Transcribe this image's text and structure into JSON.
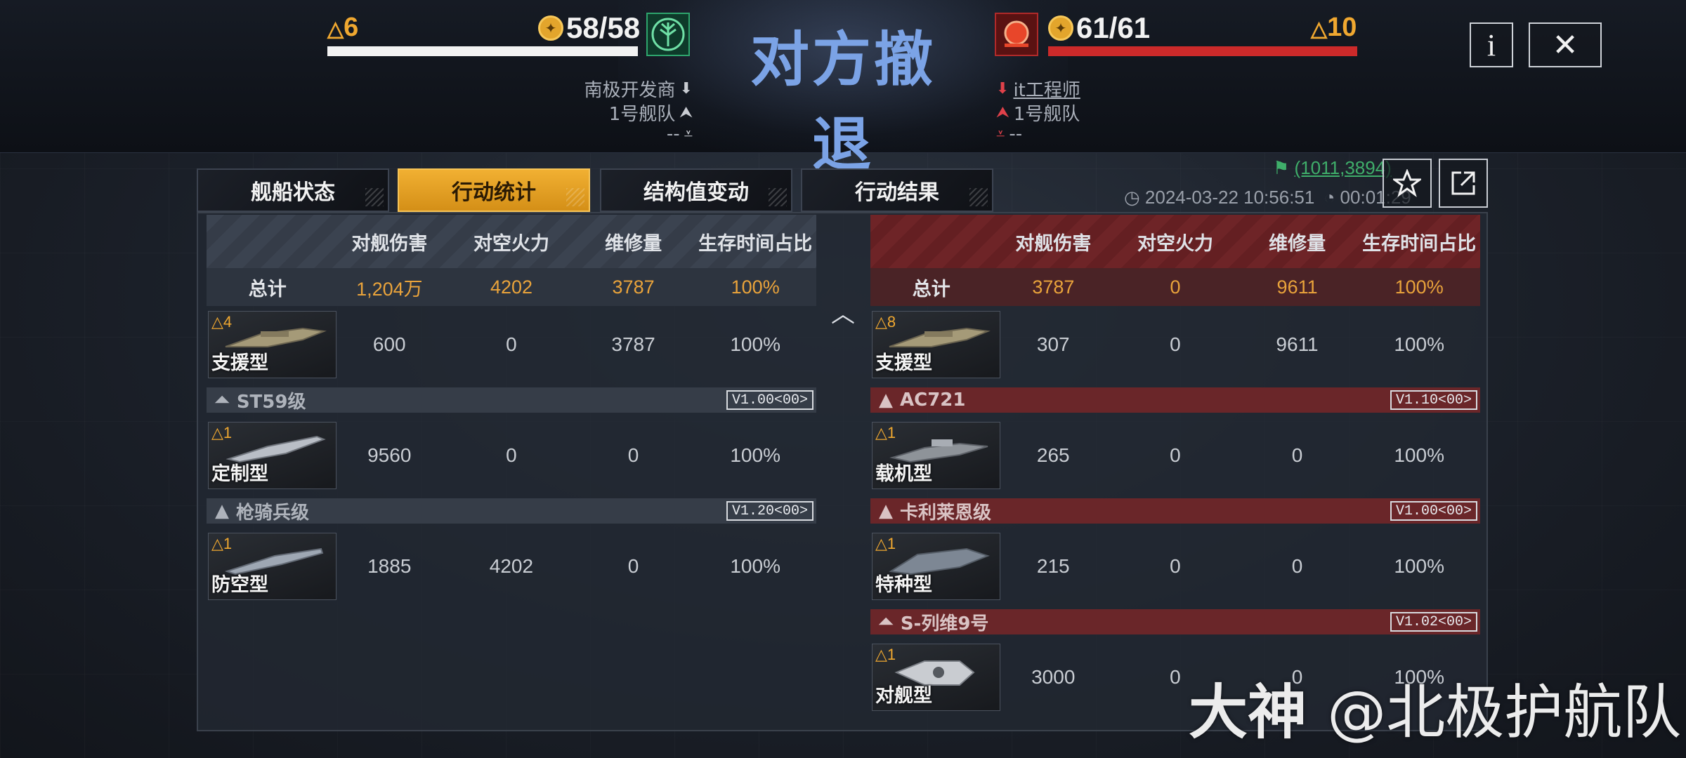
{
  "header": {
    "title": "对方撤退",
    "left": {
      "tri_count": "6",
      "ships": "58/58",
      "hp_color": "#f2f2f2",
      "player_name": "南极开发商",
      "fleet": "1号舰队",
      "extra": "--"
    },
    "right": {
      "tri_count": "10",
      "ships": "61/61",
      "hp_color": "#cc2a2a",
      "player_name": "it工程师",
      "fleet": "1号舰队",
      "extra": "--"
    },
    "info_label": "i",
    "close_label": "✕"
  },
  "tabs": [
    {
      "label": "舰船状态",
      "active": false
    },
    {
      "label": "行动统计",
      "active": true
    },
    {
      "label": "结构值变动",
      "active": false
    },
    {
      "label": "行动结果",
      "active": false
    }
  ],
  "meta": {
    "coordinates": "(1011,3894)",
    "datetime": "2024-03-22 10:56:51",
    "duration": "00:01:29"
  },
  "columns": [
    "对舰伤害",
    "对空火力",
    "维修量",
    "生存时间占比"
  ],
  "left_side": {
    "total_label": "总计",
    "totals": [
      "1,204万",
      "4202",
      "3787",
      "100%"
    ],
    "groups": [
      {
        "class_name": "",
        "version": "",
        "ships": [
          {
            "tier": "4",
            "type": "支援型",
            "values": [
              "600",
              "0",
              "3787",
              "100%"
            ]
          }
        ]
      },
      {
        "class_name": "ST59级",
        "version": "V1.00<00>",
        "ships": [
          {
            "tier": "1",
            "type": "定制型",
            "values": [
              "9560",
              "0",
              "0",
              "100%"
            ]
          }
        ]
      },
      {
        "class_name": "枪骑兵级",
        "version": "V1.20<00>",
        "ships": [
          {
            "tier": "1",
            "type": "防空型",
            "values": [
              "1885",
              "4202",
              "0",
              "100%"
            ]
          }
        ]
      }
    ]
  },
  "right_side": {
    "total_label": "总计",
    "totals": [
      "3787",
      "0",
      "9611",
      "100%"
    ],
    "groups": [
      {
        "class_name": "",
        "version": "",
        "ships": [
          {
            "tier": "8",
            "type": "支援型",
            "values": [
              "307",
              "0",
              "9611",
              "100%"
            ]
          }
        ]
      },
      {
        "class_name": "AC721",
        "version": "V1.10<00>",
        "ships": [
          {
            "tier": "1",
            "type": "载机型",
            "values": [
              "265",
              "0",
              "0",
              "100%"
            ]
          }
        ]
      },
      {
        "class_name": "卡利莱恩级",
        "version": "V1.00<00>",
        "ships": [
          {
            "tier": "1",
            "type": "特种型",
            "values": [
              "215",
              "0",
              "0",
              "100%"
            ]
          }
        ]
      },
      {
        "class_name": "S-列维9号",
        "version": "V1.02<00>",
        "ships": [
          {
            "tier": "1",
            "type": "对舰型",
            "values": [
              "3000",
              "0",
              "0",
              "100%"
            ]
          }
        ]
      }
    ]
  },
  "watermark": {
    "brand": "大神",
    "handle": "@北极护航队"
  },
  "icons": {
    "coin": "coin-icon",
    "left_emblem": "tree-emblem-icon",
    "right_emblem": "sun-emblem-icon",
    "star": "star-icon",
    "share": "share-icon",
    "flag": "flag-icon",
    "clock": "clock-icon",
    "timer": "timer-icon",
    "collapse": "chevron-up-icon"
  }
}
